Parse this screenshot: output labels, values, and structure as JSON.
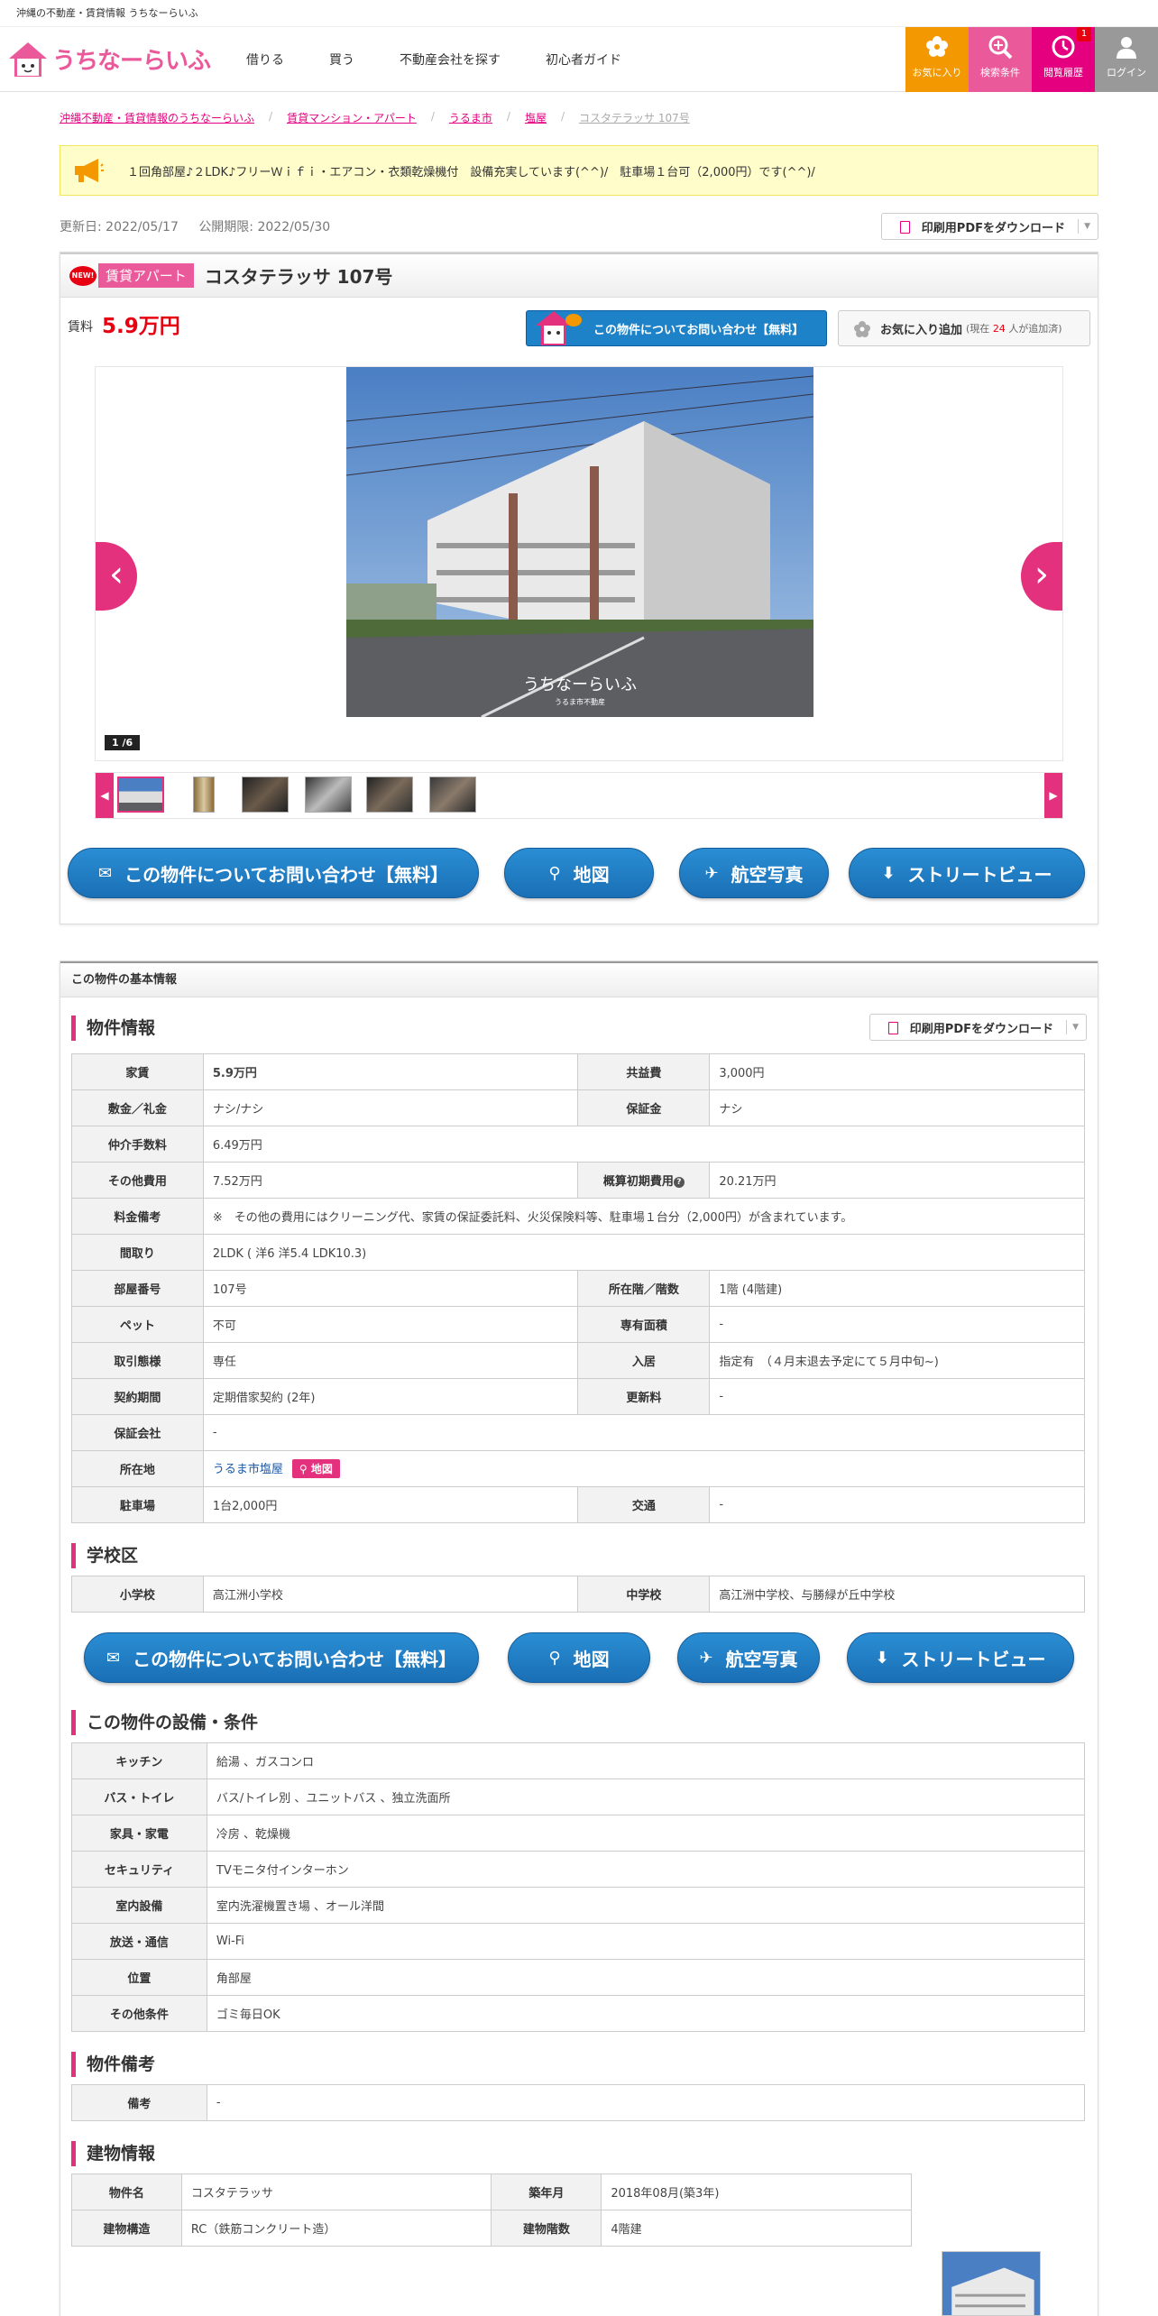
{
  "topstrip": "沖縄の不動産・賃貸情報 うちなーらいふ",
  "logo_text": "うちなーらいふ",
  "gnav": [
    "借りる",
    "買う",
    "不動産会社を探す",
    "初心者ガイド"
  ],
  "header_buttons": {
    "fav": "お気に入り",
    "search": "検索条件",
    "history": "閲覧履歴",
    "login": "ログイン",
    "history_badge": "1"
  },
  "breadcrumb": [
    "沖縄不動産・賃貸情報のうちなーらいふ",
    "賃貸マンション・アパート",
    "うるま市",
    "塩屋",
    "コスタテラッサ 107号"
  ],
  "notice": "１回角部屋♪２LDK♪フリーＷｉｆｉ・エアコン・衣類乾燥機付　設備充実しています(^^)/　駐車場１台可（2,000円）です(^^)/",
  "dates": {
    "updated": "更新日: 2022/05/17",
    "expiry": "公開期限: 2022/05/30"
  },
  "pdf_label": "印刷用PDFをダウンロード",
  "property": {
    "new_label": "NEW!",
    "type": "賃貸アパート",
    "name": "コスタテラッサ 107号",
    "price_label": "賃料",
    "price": "5.9万円"
  },
  "contact_small": "この物件についてお問い合わせ【無料】",
  "fav_button": {
    "label": "お気に入り追加",
    "sub_prefix": "(現在",
    "count": "24",
    "sub_suffix": "人が追加済)"
  },
  "gallery": {
    "counter": "1 /6",
    "watermark": "うちなーらいふ",
    "watermark_sub": "うるま市不動産"
  },
  "buttons": {
    "contact": "この物件についてお問い合わせ【無料】",
    "map": "地図",
    "aerial": "航空写真",
    "street": "ストリートビュー"
  },
  "panel_title": "この物件の基本情報",
  "sections": {
    "info": "物件情報",
    "school": "学校区",
    "equip": "この物件の設備・条件",
    "remarks": "物件備考",
    "building": "建物情報"
  },
  "info": {
    "rent_h": "家賃",
    "rent": "5.9万円",
    "common_h": "共益費",
    "common": "3,000円",
    "deposit_h": "敷金／礼金",
    "deposit": "ナシ/ナシ",
    "guarantee_h": "保証金",
    "guarantee": "ナシ",
    "brokerage_h": "仲介手数料",
    "brokerage": "6.49万円",
    "other_h": "その他費用",
    "other": "7.52万円",
    "initial_h": "概算初期費用",
    "initial": "20.21万円",
    "fee_note_h": "料金備考",
    "fee_note": "※　その他の費用にはクリーニング代、家賃の保証委託料、火災保険料等、駐車場１台分（2,000円）が含まれています。",
    "layout_h": "間取り",
    "layout": "2LDK ( 洋6 洋5.4 LDK10.3)",
    "room_h": "部屋番号",
    "room": "107号",
    "floor_h": "所在階／階数",
    "floor": "1階 (4階建)",
    "pet_h": "ペット",
    "pet": "不可",
    "area_h": "専有面積",
    "area": "-",
    "deal_h": "取引態様",
    "deal": "専任",
    "move_h": "入居",
    "move": "指定有　（４月末退去予定にて５月中旬~)",
    "contract_h": "契約期間",
    "contract": "定期借家契約 (2年)",
    "renew_h": "更新料",
    "renew": "-",
    "gcompany_h": "保証会社",
    "gcompany": "-",
    "address_h": "所在地",
    "address": "うるま市塩屋",
    "address_map": "地図",
    "parking_h": "駐車場",
    "parking": "1台2,000円",
    "transport_h": "交通",
    "transport": "-"
  },
  "school": {
    "elem_h": "小学校",
    "elem": "高江洲小学校",
    "junior_h": "中学校",
    "junior": "高江洲中学校、与勝緑が丘中学校"
  },
  "equip": [
    {
      "h": "キッチン",
      "v": "給湯 、ガスコンロ"
    },
    {
      "h": "バス・トイレ",
      "v": "バス/トイレ別 、ユニットバス 、独立洗面所"
    },
    {
      "h": "家具・家電",
      "v": "冷房 、乾燥機"
    },
    {
      "h": "セキュリティ",
      "v": "TVモニタ付インターホン"
    },
    {
      "h": "室内設備",
      "v": "室内洗濯機置き場 、オール洋間"
    },
    {
      "h": "放送・通信",
      "v": "Wi-Fi"
    },
    {
      "h": "位置",
      "v": "角部屋"
    },
    {
      "h": "その他条件",
      "v": "ゴミ毎日OK"
    }
  ],
  "remarks": {
    "h": "備考",
    "v": "-"
  },
  "building": {
    "name_h": "物件名",
    "name": "コスタテラッサ",
    "built_h": "築年月",
    "built": "2018年08月(築3年)",
    "structure_h": "建物構造",
    "structure": "RC（鉄筋コンクリート造）",
    "floors_h": "建物階数",
    "floors": "4階建"
  },
  "colors": {
    "brand_pink": "#ea5a9b",
    "accent_red": "#e60012",
    "button_blue": "#1e82c8",
    "fav_orange": "#f39800"
  }
}
